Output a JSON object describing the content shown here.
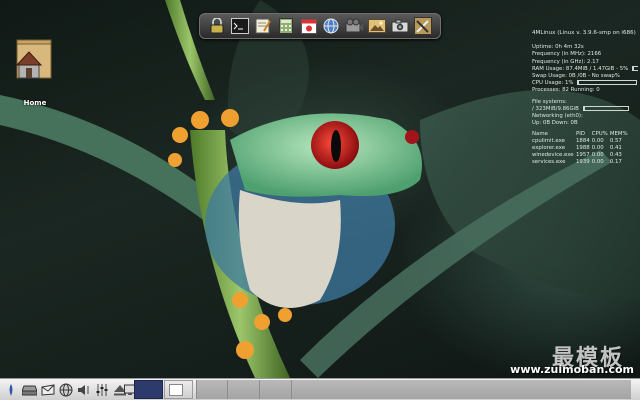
{
  "desktop": {
    "icons": [
      {
        "label": "Home",
        "icon": "home-folder-icon"
      }
    ]
  },
  "dock": {
    "items": [
      {
        "name": "lock-screen",
        "icon": "lock-icon"
      },
      {
        "name": "terminal",
        "icon": "terminal-icon"
      },
      {
        "name": "text-editor",
        "icon": "notepad-icon"
      },
      {
        "name": "calculator",
        "icon": "calculator-icon"
      },
      {
        "name": "calendar",
        "icon": "calendar-icon"
      },
      {
        "name": "web-browser",
        "icon": "globe-icon"
      },
      {
        "name": "media-player",
        "icon": "film-icon"
      },
      {
        "name": "image-viewer",
        "icon": "picture-icon"
      },
      {
        "name": "screenshot",
        "icon": "camera-icon"
      },
      {
        "name": "settings",
        "icon": "tools-icon"
      }
    ]
  },
  "monitor": {
    "title": "4MLinux (Linux v. 3.9.6-smp on i686)",
    "uptime": "Uptime: 0h 4m 32s",
    "freq_mhz": "Frequency (in MHz): 2166",
    "freq_ghz": "Frequency (in GHz): 2.17",
    "ram": "RAM Usage: 87.4MiB / 1.47GiB - 5%",
    "ram_pct": 5,
    "swap": "Swap Usage: 0B /0B - No swap%",
    "cpu": "CPU Usage: 1%",
    "cpu_pct": 1,
    "processes": "Processes: 82  Running: 0",
    "fs_header": "File systems:",
    "fs_root": "/ 323MiB/9.86GiB",
    "fs_pct": 3,
    "net_header": "Networking (eth0):",
    "net_updown": "Up: 0B     Down: 0B",
    "proc_headers": [
      "Name",
      "PID",
      "CPU%",
      "MEM%"
    ],
    "processes_list": [
      [
        "cpulimit.exe",
        "1884",
        "0.00",
        "0.57"
      ],
      [
        "explorer.exe",
        "1988",
        "0.00",
        "0.41"
      ],
      [
        "winedevice.exe",
        "1957",
        "0.00",
        "0.43"
      ],
      [
        "services.exe",
        "1939",
        "0.00",
        "0.17"
      ]
    ]
  },
  "watermark": {
    "cn": "最模板",
    "url": "www.zuimoban.com"
  },
  "taskbar": {
    "launchers": [
      {
        "name": "app-menu",
        "icon": "menu-icon"
      },
      {
        "name": "file-manager",
        "icon": "drawer-icon"
      },
      {
        "name": "email",
        "icon": "mail-icon"
      },
      {
        "name": "web",
        "icon": "globe-icon"
      },
      {
        "name": "sound",
        "icon": "speaker-icon"
      },
      {
        "name": "mixer",
        "icon": "mixer-icon"
      },
      {
        "name": "eject",
        "icon": "eject-icon"
      },
      {
        "name": "show-desktop",
        "icon": "monitor-icon"
      }
    ],
    "desktops": [
      {
        "active": true
      },
      {
        "active": false
      }
    ]
  },
  "colors": {
    "taskbar": "#dcdcdc",
    "active_desktop": "#2c3b6b",
    "dock": "#3b3b3b",
    "text": "#dfe7e3"
  }
}
